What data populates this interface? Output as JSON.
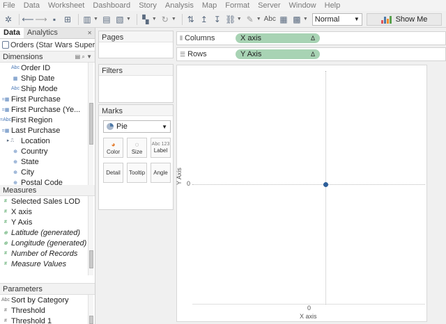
{
  "menu": [
    "File",
    "Data",
    "Worksheet",
    "Dashboard",
    "Story",
    "Analysis",
    "Map",
    "Format",
    "Server",
    "Window",
    "Help"
  ],
  "toolbar": {
    "fit_value": "Normal",
    "abc_label": "Abc",
    "show_me_label": "Show Me",
    "show_me_colors": [
      "#e15759",
      "#4e79a7",
      "#f28e2b",
      "#59a14f"
    ]
  },
  "data_pane": {
    "tabs": [
      "Data",
      "Analytics"
    ],
    "datasource": "Orders (Star Wars Super...",
    "dimensions_label": "Dimensions",
    "dimensions": [
      {
        "icon": "Abc",
        "label": "Order ID"
      },
      {
        "icon": "calendar",
        "label": "Ship Date"
      },
      {
        "icon": "Abc",
        "label": "Ship Mode"
      },
      {
        "icon": "calendar-calc",
        "label": "First Purchase"
      },
      {
        "icon": "calendar-calc",
        "label": "First Purchase (Ye..."
      },
      {
        "icon": "Abc-calc",
        "label": "First Region"
      },
      {
        "icon": "calendar-calc",
        "label": "Last Purchase"
      },
      {
        "icon": "hierarchy",
        "label": "Location"
      },
      {
        "icon": "globe",
        "label": "Country"
      },
      {
        "icon": "globe",
        "label": "State"
      },
      {
        "icon": "globe",
        "label": "City"
      },
      {
        "icon": "globe",
        "label": "Postal Code"
      }
    ],
    "measures_label": "Measures",
    "measures": [
      {
        "icon": "#",
        "label": "Selected Sales LOD",
        "italic": false
      },
      {
        "icon": "#",
        "label": "X axis",
        "italic": false
      },
      {
        "icon": "#",
        "label": "Y Axis",
        "italic": false
      },
      {
        "icon": "globe",
        "label": "Latitude (generated)",
        "italic": true
      },
      {
        "icon": "globe",
        "label": "Longitude (generated)",
        "italic": true
      },
      {
        "icon": "#",
        "label": "Number of Records",
        "italic": true
      },
      {
        "icon": "#",
        "label": "Measure Values",
        "italic": true
      }
    ],
    "parameters_label": "Parameters",
    "parameters": [
      {
        "icon": "Abc",
        "label": "Sort by Category"
      },
      {
        "icon": "#",
        "label": "Threshold"
      },
      {
        "icon": "#",
        "label": "Threshold 1"
      }
    ]
  },
  "cards": {
    "pages_label": "Pages",
    "filters_label": "Filters",
    "marks_label": "Marks",
    "mark_type": "Pie",
    "buttons": [
      {
        "label": "Color",
        "icon": "color-icon"
      },
      {
        "label": "Size",
        "icon": "size-icon"
      },
      {
        "label": "Label",
        "icon": "label-icon",
        "icon_text": "Abc 123"
      },
      {
        "label": "Detail",
        "icon": "detail-icon"
      },
      {
        "label": "Tooltip",
        "icon": "tooltip-icon"
      },
      {
        "label": "Angle",
        "icon": "angle-icon"
      }
    ]
  },
  "shelves": {
    "columns_label": "Columns",
    "columns_pill": "X axis",
    "rows_label": "Rows",
    "rows_pill": "Y Axis",
    "delta": "Δ"
  },
  "viz": {
    "y_tick": "0",
    "y_title": "Y Axis",
    "x_tick": "0",
    "x_title": "X axis",
    "point_color": "#2d5f9a"
  },
  "chart_data": {
    "type": "scatter",
    "x": [
      0
    ],
    "y": [
      0
    ],
    "xlabel": "X axis",
    "ylabel": "Y Axis",
    "title": "",
    "grid": false
  }
}
